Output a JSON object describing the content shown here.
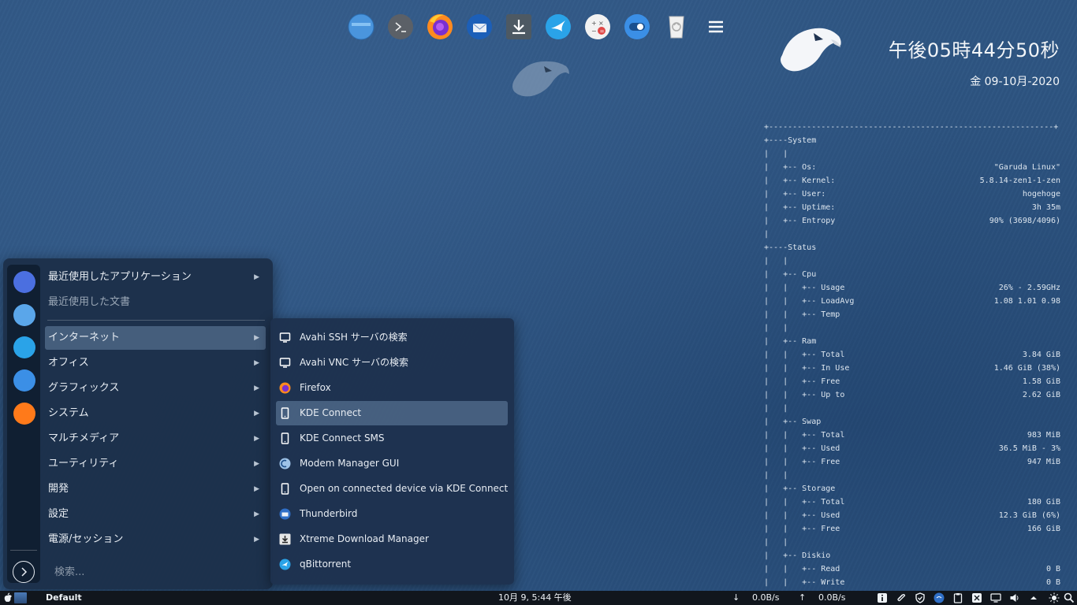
{
  "dock": {
    "items": [
      {
        "icon": "folder-icon"
      },
      {
        "icon": "terminal-icon"
      },
      {
        "icon": "firefox-icon"
      },
      {
        "icon": "thunderbird-icon"
      },
      {
        "icon": "download-manager-icon"
      },
      {
        "icon": "qbittorrent-icon"
      },
      {
        "icon": "calculator-icon"
      },
      {
        "icon": "toggle-settings-icon"
      },
      {
        "icon": "trash-icon"
      },
      {
        "icon": "hamburger-menu-icon"
      }
    ]
  },
  "clock": {
    "time": "午後05時44分50秒",
    "date": "金 09-10月-2020"
  },
  "conky": {
    "lines": [
      {
        "text": "+------------------------------------------------------------+",
        "value": ""
      },
      {
        "text": "+----System",
        "value": ""
      },
      {
        "text": "|   |",
        "value": ""
      },
      {
        "text": "|   +-- Os:",
        "value": "\"Garuda Linux\""
      },
      {
        "text": "|   +-- Kernel:",
        "value": "5.8.14-zen1-1-zen"
      },
      {
        "text": "|   +-- User:",
        "value": "hogehoge"
      },
      {
        "text": "|   +-- Uptime:",
        "value": "3h 35m"
      },
      {
        "text": "|   +-- Entropy",
        "value": "90% (3698/4096)"
      },
      {
        "text": "|",
        "value": ""
      },
      {
        "text": "+----Status",
        "value": ""
      },
      {
        "text": "|   |",
        "value": ""
      },
      {
        "text": "|   +-- Cpu",
        "value": ""
      },
      {
        "text": "|   |   +-- Usage",
        "value": "26% - 2.59GHz"
      },
      {
        "text": "|   |   +-- LoadAvg",
        "value": "1.08 1.01 0.98"
      },
      {
        "text": "|   |   +-- Temp",
        "value": ""
      },
      {
        "text": "|   |",
        "value": ""
      },
      {
        "text": "|   +-- Ram",
        "value": ""
      },
      {
        "text": "|   |   +-- Total",
        "value": "3.84 GiB"
      },
      {
        "text": "|   |   +-- In Use",
        "value": "1.46 GiB (38%)"
      },
      {
        "text": "|   |   +-- Free",
        "value": "1.58 GiB"
      },
      {
        "text": "|   |   +-- Up to",
        "value": "2.62 GiB"
      },
      {
        "text": "|   |",
        "value": ""
      },
      {
        "text": "|   +-- Swap",
        "value": ""
      },
      {
        "text": "|   |   +-- Total",
        "value": "983 MiB"
      },
      {
        "text": "|   |   +-- Used",
        "value": "36.5 MiB - 3%"
      },
      {
        "text": "|   |   +-- Free",
        "value": "947 MiB"
      },
      {
        "text": "|   |",
        "value": ""
      },
      {
        "text": "|   +-- Storage",
        "value": ""
      },
      {
        "text": "|   |   +-- Total",
        "value": "180 GiB"
      },
      {
        "text": "|   |   +-- Used",
        "value": "12.3 GiB (6%)"
      },
      {
        "text": "|   |   +-- Free",
        "value": "166 GiB"
      },
      {
        "text": "|   |",
        "value": ""
      },
      {
        "text": "|   +-- Diskio",
        "value": ""
      },
      {
        "text": "|   |   +-- Read",
        "value": "0 B"
      },
      {
        "text": "|   |   +-- Write",
        "value": "0 B"
      }
    ]
  },
  "menu": {
    "favorites": [
      {
        "icon": "garuda-welcome-icon",
        "color": "#4b6fe0"
      },
      {
        "icon": "folder-icon",
        "color": "#5aa6ea"
      },
      {
        "icon": "qbittorrent-icon",
        "color": "#2aa3e8"
      },
      {
        "icon": "toggle-settings-icon",
        "color": "#3b8fe6"
      },
      {
        "icon": "firefox-icon",
        "color": "#ff7a1a"
      }
    ],
    "categories": [
      {
        "label": "最近使用したアプリケーション",
        "arrow": "▶"
      },
      {
        "label": "最近使用した文書"
      },
      {
        "label": "インターネット",
        "arrow": "▶"
      },
      {
        "label": "オフィス",
        "arrow": "▶"
      },
      {
        "label": "グラフィックス",
        "arrow": "▶"
      },
      {
        "label": "システム",
        "arrow": "▶"
      },
      {
        "label": "マルチメディア",
        "arrow": "▶"
      },
      {
        "label": "ユーティリティ",
        "arrow": "▶"
      },
      {
        "label": "開発",
        "arrow": "▶"
      },
      {
        "label": "設定",
        "arrow": "▶"
      },
      {
        "label": "電源/セッション",
        "arrow": "▶"
      }
    ],
    "search_placeholder": "検索..."
  },
  "submenu": {
    "items": [
      {
        "label": "Avahi SSH サーバの検索",
        "icon": "monitor-icon"
      },
      {
        "label": "Avahi VNC サーバの検索",
        "icon": "monitor-icon"
      },
      {
        "label": "Firefox",
        "icon": "firefox-icon"
      },
      {
        "label": "KDE Connect",
        "icon": "smartphone-icon"
      },
      {
        "label": "KDE Connect SMS",
        "icon": "smartphone-icon"
      },
      {
        "label": "Modem Manager GUI",
        "icon": "modem-icon"
      },
      {
        "label": "Open on connected device via KDE Connect",
        "icon": "smartphone-icon"
      },
      {
        "label": "Thunderbird",
        "icon": "thunderbird-icon"
      },
      {
        "label": "Xtreme Download Manager",
        "icon": "download-manager-icon"
      },
      {
        "label": "qBittorrent",
        "icon": "qbittorrent-icon"
      }
    ]
  },
  "taskbar": {
    "layout": "Default",
    "clock": "10月 9, 5:44 午後",
    "down_arrow": "↓",
    "down_speed": "0.0B/s",
    "up_arrow": "↑",
    "up_speed": "0.0B/s"
  },
  "colors": {
    "accent": "#3daee9",
    "panel": "#11161d",
    "menu_bg": "#1c304a"
  }
}
